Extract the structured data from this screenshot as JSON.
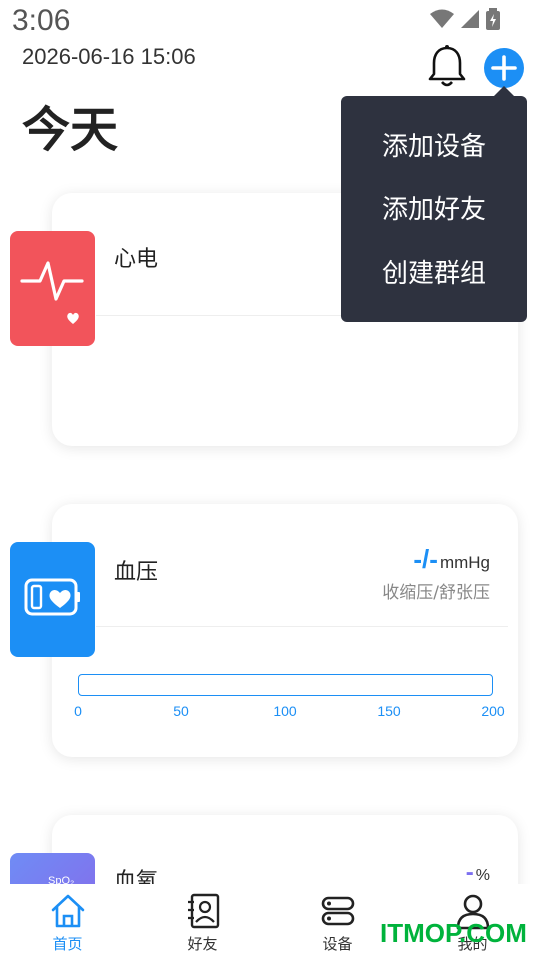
{
  "status_bar": {
    "time": "3:06"
  },
  "header": {
    "date": "2026-06-16 15:06",
    "title": "今天",
    "notification_icon": "bell-icon",
    "add_icon": "plus-icon",
    "accent_color": "#1c8ff5"
  },
  "add_menu": {
    "items": [
      {
        "label": "添加设备"
      },
      {
        "label": "添加好友"
      },
      {
        "label": "创建群组"
      }
    ],
    "background": "#2e323f"
  },
  "cards": {
    "ecg": {
      "title": "心电",
      "icon": "heart-rate-icon",
      "color": "#f2545b"
    },
    "bp": {
      "title": "血压",
      "icon": "blood-pressure-icon",
      "color": "#1c8ff5",
      "value": "-/-",
      "unit": "mmHg",
      "subtitle": "收缩压/舒张压",
      "scale_ticks": [
        "0",
        "50",
        "100",
        "150",
        "200"
      ]
    },
    "spo2": {
      "title": "血氧",
      "icon": "spo2-icon",
      "icon_text": "SpO₂",
      "value": "-",
      "unit": "%",
      "color": "#7c6ff0"
    }
  },
  "tab_bar": {
    "tabs": [
      {
        "label": "首页",
        "icon": "home-icon",
        "active": true
      },
      {
        "label": "好友",
        "icon": "contacts-icon",
        "active": false
      },
      {
        "label": "设备",
        "icon": "device-icon",
        "active": false
      },
      {
        "label": "我的",
        "icon": "profile-icon",
        "active": false
      }
    ]
  },
  "watermark": "ITMOP.COM"
}
